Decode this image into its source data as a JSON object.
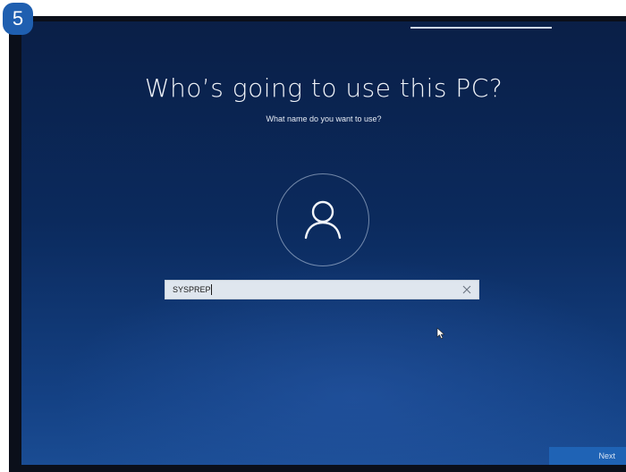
{
  "step_badge": "5",
  "oobe": {
    "title": "Who’s going to use this PC?",
    "subtitle": "What name do you want to use?",
    "name_input": {
      "value": "SYSPREP",
      "placeholder": ""
    },
    "next_label": "Next"
  },
  "icons": {
    "avatar": "person-icon",
    "clear": "close-icon",
    "pointer": "mouse-pointer-icon"
  },
  "colors": {
    "background_top": "#0a1f47",
    "background_bottom": "#1a4c93",
    "input_fill": "#dfe6ee",
    "next_button": "#1f63b5",
    "badge": "#1f5fb0"
  }
}
